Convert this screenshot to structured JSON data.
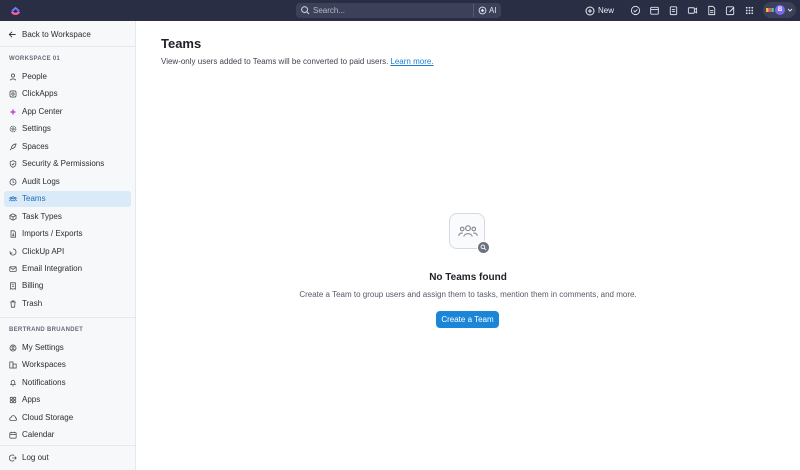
{
  "topbar": {
    "search_placeholder": "Search...",
    "ai_label": "AI",
    "new_label": "New",
    "avatar_initial": "B",
    "icons": [
      "check-circle-icon",
      "calendar-icon",
      "clipboard-icon",
      "video-icon",
      "document-icon",
      "edit-icon",
      "grid-icon"
    ]
  },
  "sidebar": {
    "back_label": "Back to Workspace",
    "workspace_header": "WORKSPACE 01",
    "workspace_items": [
      {
        "label": "People",
        "icon": "person-icon"
      },
      {
        "label": "ClickApps",
        "icon": "clickapps-icon"
      },
      {
        "label": "App Center",
        "icon": "app-center-icon"
      },
      {
        "label": "Settings",
        "icon": "gear-icon"
      },
      {
        "label": "Spaces",
        "icon": "rocket-icon"
      },
      {
        "label": "Security & Permissions",
        "icon": "shield-icon"
      },
      {
        "label": "Audit Logs",
        "icon": "clock-icon"
      },
      {
        "label": "Teams",
        "icon": "teams-icon",
        "active": true
      },
      {
        "label": "Task Types",
        "icon": "box-icon"
      },
      {
        "label": "Imports / Exports",
        "icon": "import-icon"
      },
      {
        "label": "ClickUp API",
        "icon": "api-icon"
      },
      {
        "label": "Email Integration",
        "icon": "mail-icon"
      },
      {
        "label": "Billing",
        "icon": "billing-icon"
      },
      {
        "label": "Trash",
        "icon": "trash-icon"
      }
    ],
    "user_header": "BERTRAND BRUANDET",
    "user_items": [
      {
        "label": "My Settings",
        "icon": "user-settings-icon"
      },
      {
        "label": "Workspaces",
        "icon": "workspaces-icon"
      },
      {
        "label": "Notifications",
        "icon": "bell-icon"
      },
      {
        "label": "Apps",
        "icon": "apps-icon"
      },
      {
        "label": "Cloud Storage",
        "icon": "cloud-icon"
      },
      {
        "label": "Calendar",
        "icon": "calendar-icon"
      }
    ],
    "logout_label": "Log out"
  },
  "main": {
    "title": "Teams",
    "subtitle": "View-only users added to Teams will be converted to paid users.",
    "learn_more": "Learn more.",
    "empty_title": "No Teams found",
    "empty_desc": "Create a Team to group users and assign them to tasks, mention them in comments, and more.",
    "cta_label": "Create a Team"
  },
  "colors": {
    "topbar": "#2a2e45",
    "accent": "#1b86d8",
    "active_item_bg": "#dbeaf9",
    "avatar": "#7b68ee"
  }
}
